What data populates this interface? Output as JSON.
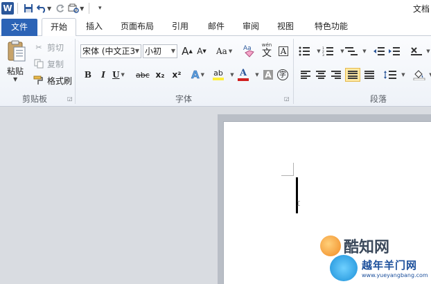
{
  "window": {
    "title": "文档"
  },
  "quick_access": {
    "app_icon": "W"
  },
  "tabs": [
    {
      "label": "文件"
    },
    {
      "label": "开始"
    },
    {
      "label": "插入"
    },
    {
      "label": "页面布局"
    },
    {
      "label": "引用"
    },
    {
      "label": "邮件"
    },
    {
      "label": "审阅"
    },
    {
      "label": "视图"
    },
    {
      "label": "特色功能"
    }
  ],
  "clipboard": {
    "paste_label": "粘贴",
    "cut_label": "剪切",
    "copy_label": "复制",
    "format_painter_label": "格式刷",
    "group_label": "剪贴板"
  },
  "font": {
    "font_name": "宋体 (中文正3",
    "font_size": "小初",
    "grow_label": "A",
    "shrink_label": "A",
    "change_case_label": "Aa",
    "phonetic_label": "wén",
    "phonetic_char": "文",
    "border_char": "A",
    "bold_label": "B",
    "italic_label": "I",
    "underline_label": "U",
    "strike_label": "abc",
    "subscript_label": "x₂",
    "superscript_label": "x²",
    "effects_label": "A",
    "highlight_label": "ab",
    "font_color_label": "A",
    "shading_label": "A",
    "enclose_label": "字",
    "group_label": "字体"
  },
  "paragraph": {
    "group_label": "段落"
  },
  "watermarks": {
    "site1": "酷知网",
    "site2": "越年羊门网",
    "site2_url": "www.yueyangbang.com"
  },
  "colors": {
    "file_tab": "#2b63b6",
    "highlight": "#ffef3a",
    "font_color": "#d02020",
    "selected_button": "#fde8a4"
  }
}
